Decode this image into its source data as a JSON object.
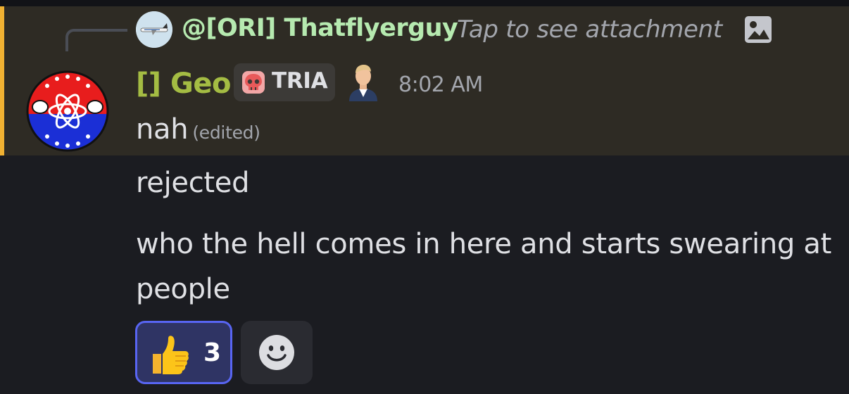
{
  "reply": {
    "author": "@[ORI] Thatflyerguy",
    "preview": "Tap to see attachment",
    "attachment_icon": "image-icon"
  },
  "message": {
    "author": "[] Geo",
    "tag_label": "TRIA",
    "tag_icon": "skull-icon",
    "role_icon": "person-icon",
    "timestamp": "8:02 AM",
    "lines": [
      {
        "text": "nah",
        "edited": "(edited)"
      },
      {
        "text": "rejected"
      },
      {
        "text": "who the hell comes in here and starts swearing at people"
      }
    ]
  },
  "reactions": [
    {
      "emoji": "thumbs-up-icon",
      "count": "3",
      "selected": true
    }
  ],
  "add_reaction_icon": "smiley-icon",
  "colors": {
    "highlight_bar": "#f0b132",
    "highlight_bg": "#2e2b24",
    "author": "#a4bc43",
    "reply_author": "#b6eab0",
    "reaction_border": "#5865f2"
  }
}
